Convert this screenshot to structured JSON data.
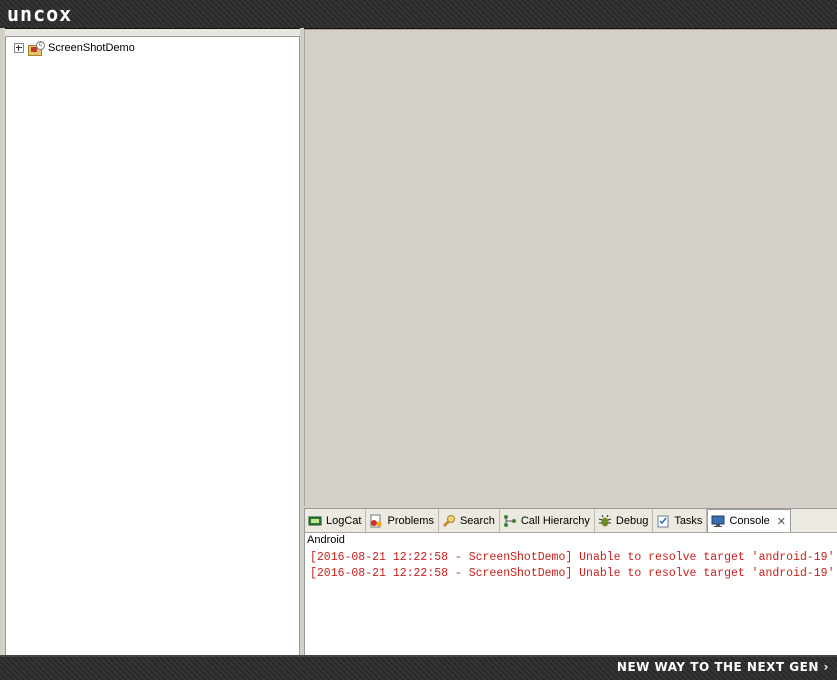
{
  "topbar": {
    "logo": "uncox"
  },
  "footer": {
    "slogan": "NEW WAY TO THE NEXT GEN ›"
  },
  "explorer": {
    "items": [
      {
        "label": "ScreenShotDemo",
        "icon": "android-project-icon"
      }
    ]
  },
  "bottom_tabs": [
    {
      "label": "LogCat",
      "icon": "logcat-icon"
    },
    {
      "label": "Problems",
      "icon": "problems-icon"
    },
    {
      "label": "Search",
      "icon": "search-icon"
    },
    {
      "label": "Call Hierarchy",
      "icon": "call-hierarchy-icon"
    },
    {
      "label": "Debug",
      "icon": "debug-icon"
    },
    {
      "label": "Tasks",
      "icon": "tasks-icon"
    },
    {
      "label": "Console",
      "icon": "console-icon",
      "active": true
    }
  ],
  "console": {
    "title": "Android",
    "lines": [
      "[2016-08-21 12:22:58 - ScreenShotDemo] Unable to resolve target 'android-19'",
      "[2016-08-21 12:22:58 - ScreenShotDemo] Unable to resolve target 'android-19'"
    ]
  },
  "colors": {
    "error_text": "#c8201e",
    "panel_bg": "#d4d0c8"
  }
}
